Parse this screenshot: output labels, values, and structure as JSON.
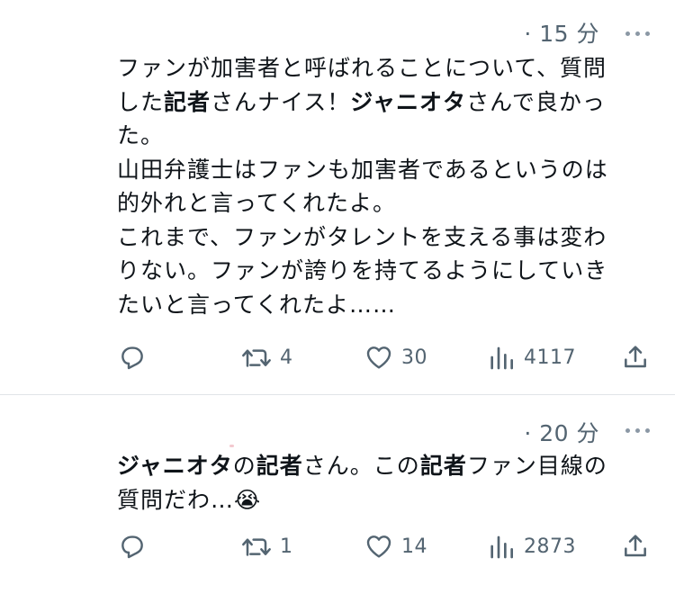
{
  "tweets": [
    {
      "time": "· 15 分",
      "lines": [
        [
          {
            "t": "ファンが加害者と呼ばれることについて、質問",
            "b": false
          }
        ],
        [
          {
            "t": "した",
            "b": false
          },
          {
            "t": "記者",
            "b": true
          },
          {
            "t": "さんナイス！",
            "b": false
          },
          {
            "t": "ジャニオタ",
            "b": true
          },
          {
            "t": "さんで良かっ",
            "b": false
          }
        ],
        [
          {
            "t": "た。",
            "b": false
          }
        ],
        [
          {
            "t": "山田弁護士はファンも加害者であるというのは",
            "b": false
          }
        ],
        [
          {
            "t": "的外れと言ってくれたよ。",
            "b": false
          }
        ],
        [
          {
            "t": "これまで、ファンがタレントを支える事は変わ",
            "b": false
          }
        ],
        [
          {
            "t": "りない。ファンが誇りを持てるようにしていき",
            "b": false
          }
        ],
        [
          {
            "t": "たいと言ってくれたよ……",
            "b": false
          }
        ]
      ],
      "retweets": "4",
      "likes": "30",
      "views": "4117"
    },
    {
      "time": "· 20 分",
      "lines": [
        [
          {
            "t": "ジャニオタ",
            "b": true
          },
          {
            "t": "の",
            "b": false
          },
          {
            "t": "記者",
            "b": true
          },
          {
            "t": "さん。この",
            "b": false
          },
          {
            "t": "記者",
            "b": true
          },
          {
            "t": "ファン目線の",
            "b": false
          }
        ],
        [
          {
            "t": "質問だわ…😭",
            "b": false
          }
        ]
      ],
      "retweets": "1",
      "likes": "14",
      "views": "2873"
    }
  ],
  "icons": {
    "reply": "reply-icon",
    "retweet": "retweet-icon",
    "like": "heart-icon",
    "views": "views-icon",
    "share": "share-icon",
    "more": "more-icon"
  },
  "colors": {
    "text": "#0f1419",
    "muted": "#536471",
    "divider": "#e1e4e8"
  }
}
